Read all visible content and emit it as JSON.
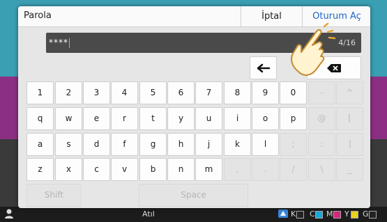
{
  "background": {
    "bands": [
      {
        "color": "#3a9fb3"
      },
      {
        "color": "#8c2f84"
      },
      {
        "color": "#3a3a3a"
      }
    ]
  },
  "status_bar": {
    "center_text": "Atıl",
    "inks": [
      {
        "label": "K",
        "color": "#222222"
      },
      {
        "label": "C",
        "color": "#18a7d8"
      },
      {
        "label": "M",
        "color": "#d7257c"
      },
      {
        "label": "Y",
        "color": "#e9d21a"
      },
      {
        "label": "G",
        "color": "#222222"
      }
    ]
  },
  "dialog": {
    "title": "Parola",
    "cancel_label": "İptal",
    "login_label": "Oturum Aç",
    "password_mask": "****",
    "char_count": "4/16",
    "left_arrow_icon": "arrow-left-icon",
    "backspace_icon": "backspace-icon"
  },
  "keyboard": {
    "rows": [
      [
        "1",
        "2",
        "3",
        "4",
        "5",
        "6",
        "7",
        "8",
        "9",
        "0",
        "-",
        "^"
      ],
      [
        "q",
        "w",
        "e",
        "r",
        "t",
        "y",
        "u",
        "i",
        "o",
        "p",
        "@",
        "["
      ],
      [
        "a",
        "s",
        "d",
        "f",
        "g",
        "h",
        "j",
        "k",
        "l",
        ";",
        ":",
        "]"
      ],
      [
        "z",
        "x",
        "c",
        "v",
        "b",
        "n",
        "m",
        ",",
        ".",
        "/",
        "\\",
        "_"
      ]
    ],
    "shift_label": "Shift",
    "space_label": "Space"
  },
  "colors": {
    "accent": "#1d66c7",
    "field_bg": "#4a4a4a",
    "caret": "#6fb7ff"
  }
}
